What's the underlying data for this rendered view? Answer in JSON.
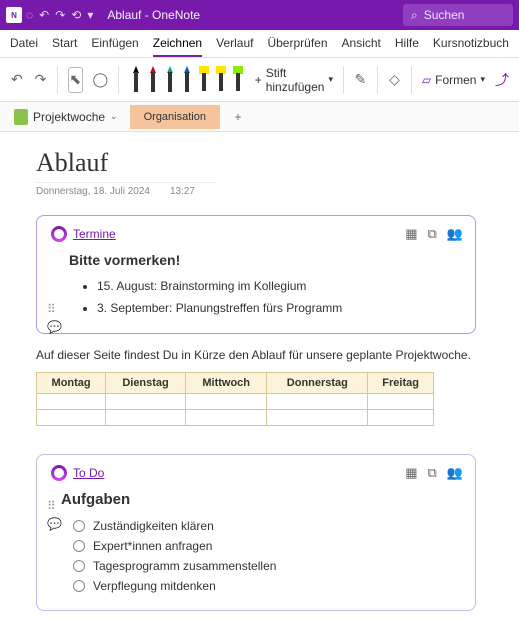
{
  "titlebar": {
    "app_name": "OneNote",
    "doc_title": "Ablauf",
    "title_display": "Ablauf  -  OneNote",
    "search_placeholder": "Suchen"
  },
  "ribbon_tabs": {
    "file": "Datei",
    "home": "Start",
    "insert": "Einfügen",
    "draw": "Zeichnen",
    "history": "Verlauf",
    "review": "Überprüfen",
    "view": "Ansicht",
    "help": "Hilfe",
    "class_notebook": "Kursnotizbuch"
  },
  "ribbon": {
    "add_pen": "Stift hinzufügen",
    "shapes": "Formen"
  },
  "sections": {
    "notebook": "Projektwoche",
    "current": "Organisation"
  },
  "page": {
    "title": "Ablauf",
    "date": "Donnerstag, 18. Juli 2024",
    "time": "13:27"
  },
  "loop_termine": {
    "link": "Termine",
    "heading": "Bitte vormerken!",
    "items": [
      "15. August: Brainstorming im Kollegium",
      "3. September: Planungstreffen fürs Programm"
    ]
  },
  "intro": "Auf dieser Seite findest Du in Kürze den Ablauf für unsere geplante Projektwoche.",
  "schedule_headers": [
    "Montag",
    "Dienstag",
    "Mittwoch",
    "Donnerstag",
    "Freitag"
  ],
  "loop_todo": {
    "link": "To Do",
    "heading": "Aufgaben",
    "tasks": [
      "Zuständigkeiten klären",
      "Expert*innen anfragen",
      "Tagesprogramm zusammenstellen",
      "Verpflegung mitdenken"
    ]
  }
}
